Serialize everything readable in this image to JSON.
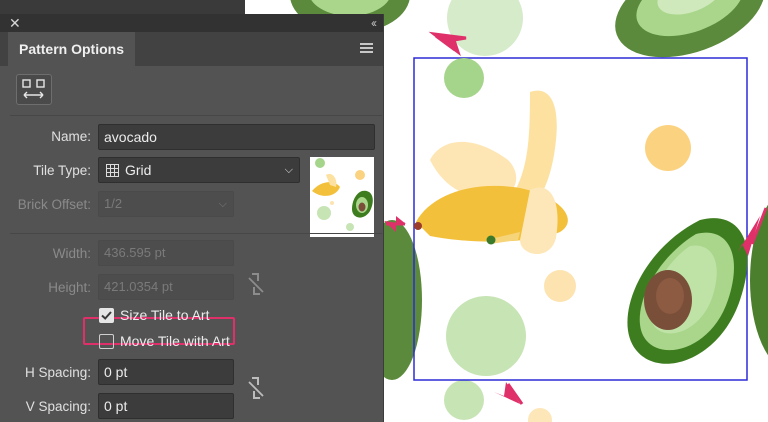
{
  "panel": {
    "title": "Pattern Options",
    "fields": {
      "name_label": "Name:",
      "name_value": "avocado",
      "tile_type_label": "Tile Type:",
      "tile_type_value": "Grid",
      "brick_offset_label": "Brick Offset:",
      "brick_offset_value": "1/2",
      "width_label": "Width:",
      "width_value": "436.595 pt",
      "height_label": "Height:",
      "height_value": "421.0354 pt",
      "h_spacing_label": "H Spacing:",
      "h_spacing_value": "0 pt",
      "v_spacing_label": "V Spacing:",
      "v_spacing_value": "0 pt"
    },
    "checkboxes": {
      "size_tile_to_art": {
        "label": "Size Tile to Art",
        "checked": true
      },
      "move_tile_with_art": {
        "label": "Move Tile with Art",
        "checked": false
      }
    },
    "icons": [
      "close-icon",
      "collapse-icon",
      "menu-icon",
      "fit-tile-icon",
      "grid-icon",
      "chevron-down-icon",
      "link-icon"
    ]
  },
  "colors": {
    "tile_boundary": "#2b2bd6",
    "annotation": "#e0306a",
    "avocado_dark": "#3e7d1f",
    "avocado_light": "#a9d68b",
    "banana": "#f5c84a",
    "dot_green": "#b9dfa6",
    "dot_yellow": "#fbd891"
  }
}
